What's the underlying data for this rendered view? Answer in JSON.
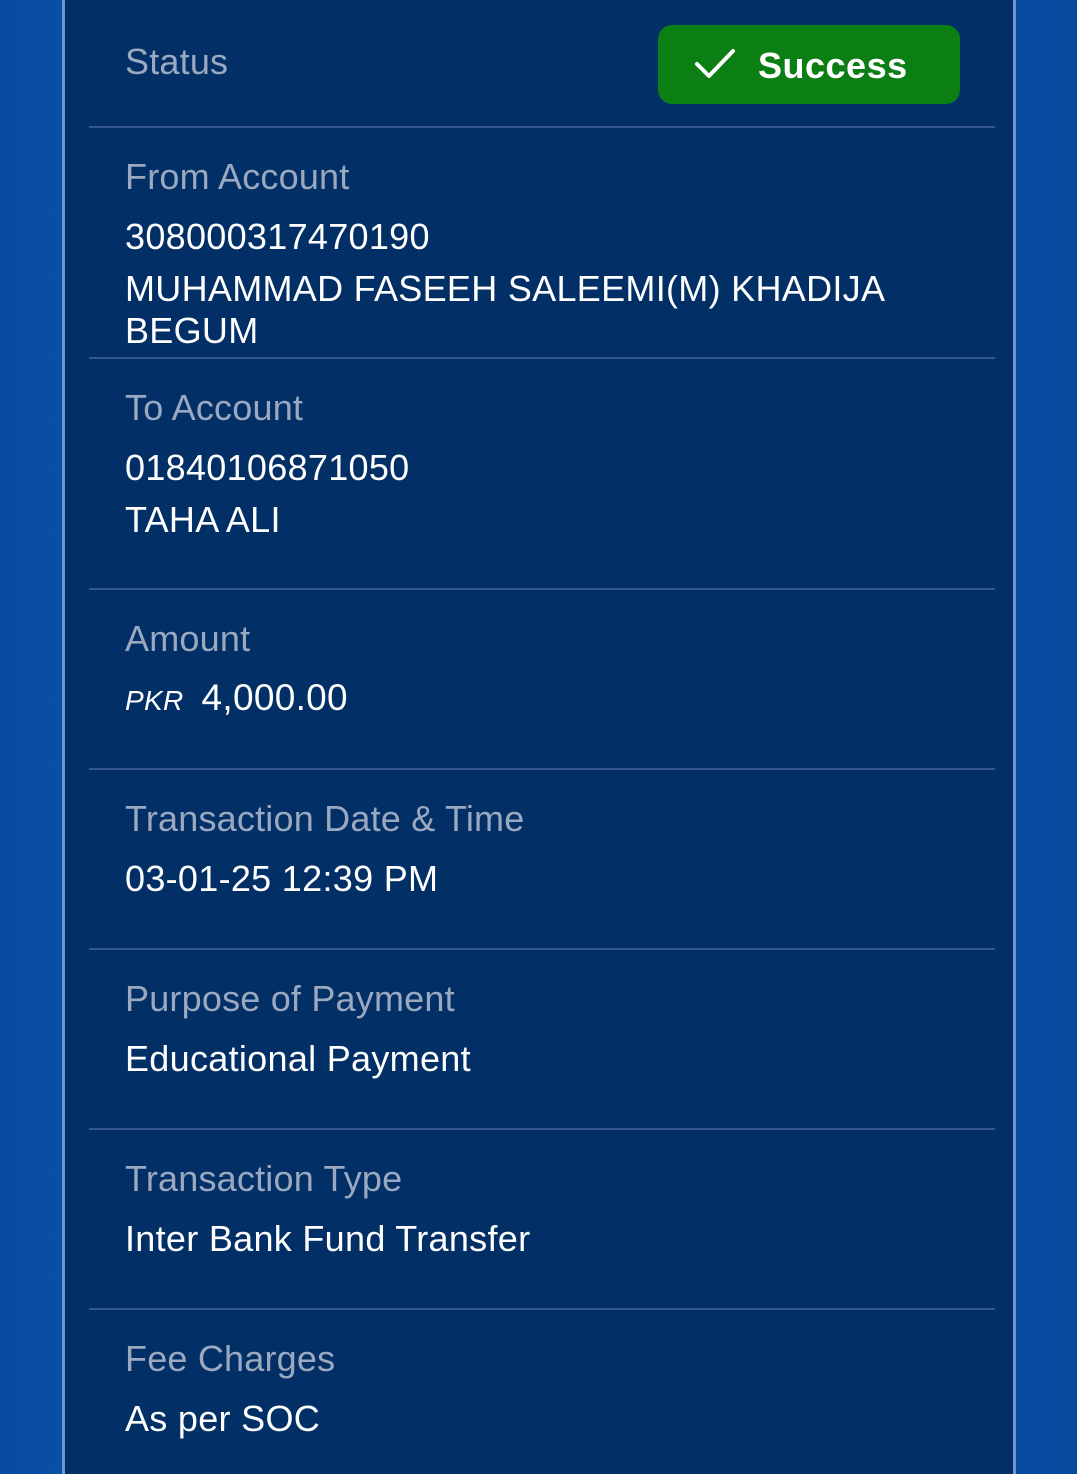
{
  "status": {
    "label": "Status",
    "badge_text": "Success"
  },
  "from_account": {
    "label": "From Account",
    "number": "308000317470190",
    "name": "MUHAMMAD FASEEH SALEEMI(M) KHADIJA BEGUM"
  },
  "to_account": {
    "label": "To Account",
    "number": "01840106871050",
    "name": "TAHA ALI"
  },
  "amount": {
    "label": "Amount",
    "currency": "PKR",
    "value": "4,000.00"
  },
  "transaction_datetime": {
    "label": "Transaction Date & Time",
    "value": "03-01-25 12:39 PM"
  },
  "purpose": {
    "label": "Purpose of Payment",
    "value": "Educational Payment"
  },
  "transaction_type": {
    "label": "Transaction Type",
    "value": "Inter Bank Fund Transfer"
  },
  "fee_charges": {
    "label": "Fee Charges",
    "value": "As per SOC"
  },
  "colors": {
    "card_bg": "#022f66",
    "success_green": "#0b7f14",
    "label_gray": "#9aa9bf",
    "divider": "#34588d"
  }
}
